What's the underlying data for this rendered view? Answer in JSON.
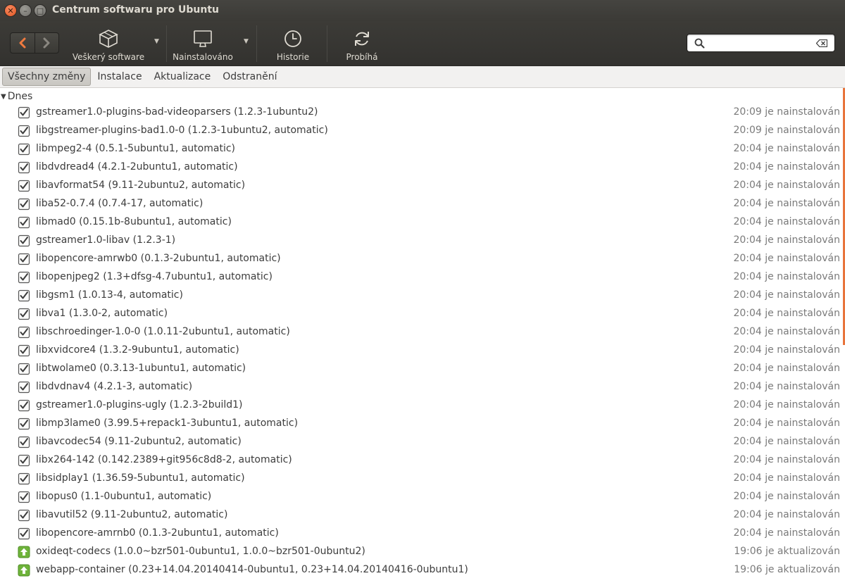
{
  "window": {
    "title": "Centrum softwaru pro Ubuntu"
  },
  "toolbar": {
    "all_software": "Veškerý software",
    "installed": "Nainstalováno",
    "history": "Historie",
    "progress": "Probíhá",
    "search": {
      "value": "",
      "placeholder": ""
    }
  },
  "tabs": [
    "Všechny změny",
    "Instalace",
    "Aktualizace",
    "Odstranění"
  ],
  "group": "Dnes",
  "colors": {
    "accent": "#e8743b",
    "update_icon": "#6eb33a"
  },
  "items": [
    {
      "icon": "checkbox-icon",
      "name": "gstreamer1.0-plugins-bad-videoparsers (1.2.3-1ubuntu2)",
      "time": "20:09 je nainstalován"
    },
    {
      "icon": "checkbox-icon",
      "name": "libgstreamer-plugins-bad1.0-0 (1.2.3-1ubuntu2, automatic)",
      "time": "20:09 je nainstalován"
    },
    {
      "icon": "checkbox-icon",
      "name": "libmpeg2-4 (0.5.1-5ubuntu1, automatic)",
      "time": "20:04 je nainstalován"
    },
    {
      "icon": "checkbox-icon",
      "name": "libdvdread4 (4.2.1-2ubuntu1, automatic)",
      "time": "20:04 je nainstalován"
    },
    {
      "icon": "checkbox-icon",
      "name": "libavformat54 (9.11-2ubuntu2, automatic)",
      "time": "20:04 je nainstalován"
    },
    {
      "icon": "checkbox-icon",
      "name": "liba52-0.7.4 (0.7.4-17, automatic)",
      "time": "20:04 je nainstalován"
    },
    {
      "icon": "checkbox-icon",
      "name": "libmad0 (0.15.1b-8ubuntu1, automatic)",
      "time": "20:04 je nainstalován"
    },
    {
      "icon": "checkbox-icon",
      "name": "gstreamer1.0-libav (1.2.3-1)",
      "time": "20:04 je nainstalován"
    },
    {
      "icon": "checkbox-icon",
      "name": "libopencore-amrwb0 (0.1.3-2ubuntu1, automatic)",
      "time": "20:04 je nainstalován"
    },
    {
      "icon": "checkbox-icon",
      "name": "libopenjpeg2 (1.3+dfsg-4.7ubuntu1, automatic)",
      "time": "20:04 je nainstalován"
    },
    {
      "icon": "checkbox-icon",
      "name": "libgsm1 (1.0.13-4, automatic)",
      "time": "20:04 je nainstalován"
    },
    {
      "icon": "checkbox-icon",
      "name": "libva1 (1.3.0-2, automatic)",
      "time": "20:04 je nainstalován"
    },
    {
      "icon": "checkbox-icon",
      "name": "libschroedinger-1.0-0 (1.0.11-2ubuntu1, automatic)",
      "time": "20:04 je nainstalován"
    },
    {
      "icon": "checkbox-icon",
      "name": "libxvidcore4 (1.3.2-9ubuntu1, automatic)",
      "time": "20:04 je nainstalován"
    },
    {
      "icon": "checkbox-icon",
      "name": "libtwolame0 (0.3.13-1ubuntu1, automatic)",
      "time": "20:04 je nainstalován"
    },
    {
      "icon": "checkbox-icon",
      "name": "libdvdnav4 (4.2.1-3, automatic)",
      "time": "20:04 je nainstalován"
    },
    {
      "icon": "checkbox-icon",
      "name": "gstreamer1.0-plugins-ugly (1.2.3-2build1)",
      "time": "20:04 je nainstalován"
    },
    {
      "icon": "checkbox-icon",
      "name": "libmp3lame0 (3.99.5+repack1-3ubuntu1, automatic)",
      "time": "20:04 je nainstalován"
    },
    {
      "icon": "checkbox-icon",
      "name": "libavcodec54 (9.11-2ubuntu2, automatic)",
      "time": "20:04 je nainstalován"
    },
    {
      "icon": "checkbox-icon",
      "name": "libx264-142 (0.142.2389+git956c8d8-2, automatic)",
      "time": "20:04 je nainstalován"
    },
    {
      "icon": "checkbox-icon",
      "name": "libsidplay1 (1.36.59-5ubuntu1, automatic)",
      "time": "20:04 je nainstalován"
    },
    {
      "icon": "checkbox-icon",
      "name": "libopus0 (1.1-0ubuntu1, automatic)",
      "time": "20:04 je nainstalován"
    },
    {
      "icon": "checkbox-icon",
      "name": "libavutil52 (9.11-2ubuntu2, automatic)",
      "time": "20:04 je nainstalován"
    },
    {
      "icon": "checkbox-icon",
      "name": "libopencore-amrnb0 (0.1.3-2ubuntu1, automatic)",
      "time": "20:04 je nainstalován"
    },
    {
      "icon": "update-arrow-icon",
      "name": "oxideqt-codecs (1.0.0~bzr501-0ubuntu1, 1.0.0~bzr501-0ubuntu2)",
      "time": "19:06 je aktualizován"
    },
    {
      "icon": "update-arrow-icon",
      "name": "webapp-container (0.23+14.04.20140414-0ubuntu1, 0.23+14.04.20140416-0ubuntu1)",
      "time": "19:06 je aktualizován"
    }
  ]
}
